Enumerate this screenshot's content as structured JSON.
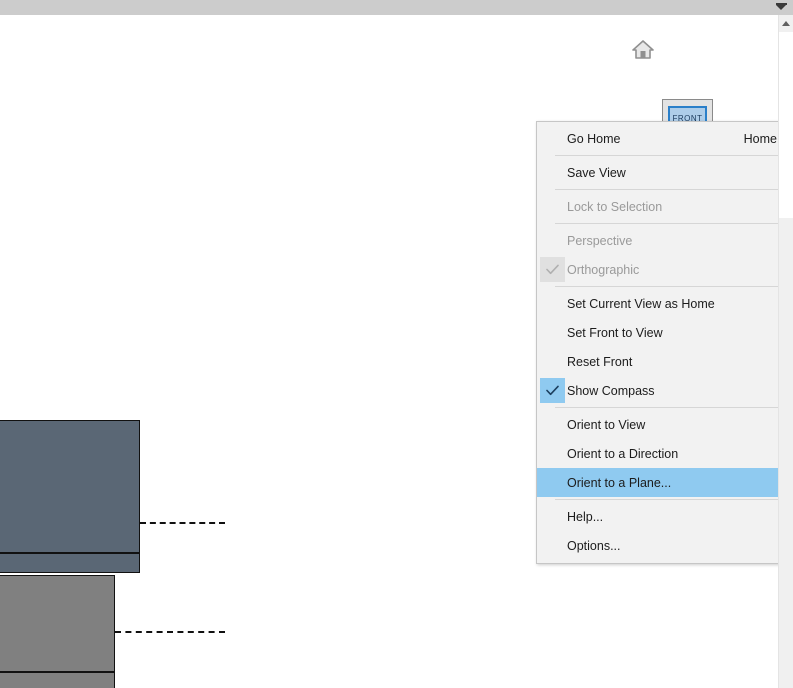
{
  "top_bar": {
    "overflow_icon": "chevron-down-icon"
  },
  "scrollbar": {
    "up_arrow_icon": "scroll-up-arrow-icon"
  },
  "viewport": {
    "home_icon": "home-icon",
    "viewcube": {
      "icon": "viewcube",
      "face_label": "FRONT"
    },
    "geometry": [
      {
        "name": "block-a-main",
        "color": "#5a6775"
      },
      {
        "name": "block-a-base",
        "color": "#5a6775"
      },
      {
        "name": "block-b-main",
        "color": "#808080"
      },
      {
        "name": "block-b-base",
        "color": "#808080"
      }
    ],
    "centerlines": [
      {
        "name": "centerline-a"
      },
      {
        "name": "centerline-b"
      }
    ]
  },
  "context_menu": {
    "highlight_color": "#8fcaf0",
    "items": [
      {
        "id": "go-home",
        "label": "Go Home",
        "shortcut": "Home",
        "state": "normal",
        "check": "none",
        "submenu": false
      },
      {
        "separator": true
      },
      {
        "id": "save-view",
        "label": "Save View",
        "shortcut": "",
        "state": "normal",
        "check": "none",
        "submenu": false
      },
      {
        "separator": true
      },
      {
        "id": "lock-to-selection",
        "label": "Lock to Selection",
        "shortcut": "",
        "state": "disabled",
        "check": "none",
        "submenu": false
      },
      {
        "separator": true
      },
      {
        "id": "perspective",
        "label": "Perspective",
        "shortcut": "",
        "state": "disabled",
        "check": "none",
        "submenu": false
      },
      {
        "id": "orthographic",
        "label": "Orthographic",
        "shortcut": "",
        "state": "disabled",
        "check": "checked-disabled",
        "submenu": false
      },
      {
        "separator": true
      },
      {
        "id": "set-current-view-as-home",
        "label": "Set Current View as Home",
        "shortcut": "",
        "state": "normal",
        "check": "none",
        "submenu": false
      },
      {
        "id": "set-front-to-view",
        "label": "Set Front to View",
        "shortcut": "",
        "state": "normal",
        "check": "none",
        "submenu": true
      },
      {
        "id": "reset-front",
        "label": "Reset Front",
        "shortcut": "",
        "state": "normal",
        "check": "none",
        "submenu": false
      },
      {
        "id": "show-compass",
        "label": "Show Compass",
        "shortcut": "",
        "state": "normal",
        "check": "checked-active",
        "submenu": false
      },
      {
        "separator": true
      },
      {
        "id": "orient-to-view",
        "label": "Orient to View",
        "shortcut": "",
        "state": "normal",
        "check": "none",
        "submenu": true
      },
      {
        "id": "orient-to-a-direction",
        "label": "Orient to a Direction",
        "shortcut": "",
        "state": "normal",
        "check": "none",
        "submenu": true
      },
      {
        "id": "orient-to-a-plane",
        "label": "Orient to a Plane...",
        "shortcut": "",
        "state": "highlight",
        "check": "none",
        "submenu": false
      },
      {
        "separator": true
      },
      {
        "id": "help",
        "label": "Help...",
        "shortcut": "",
        "state": "normal",
        "check": "none",
        "submenu": false
      },
      {
        "id": "options",
        "label": "Options...",
        "shortcut": "",
        "state": "normal",
        "check": "none",
        "submenu": false
      }
    ]
  }
}
